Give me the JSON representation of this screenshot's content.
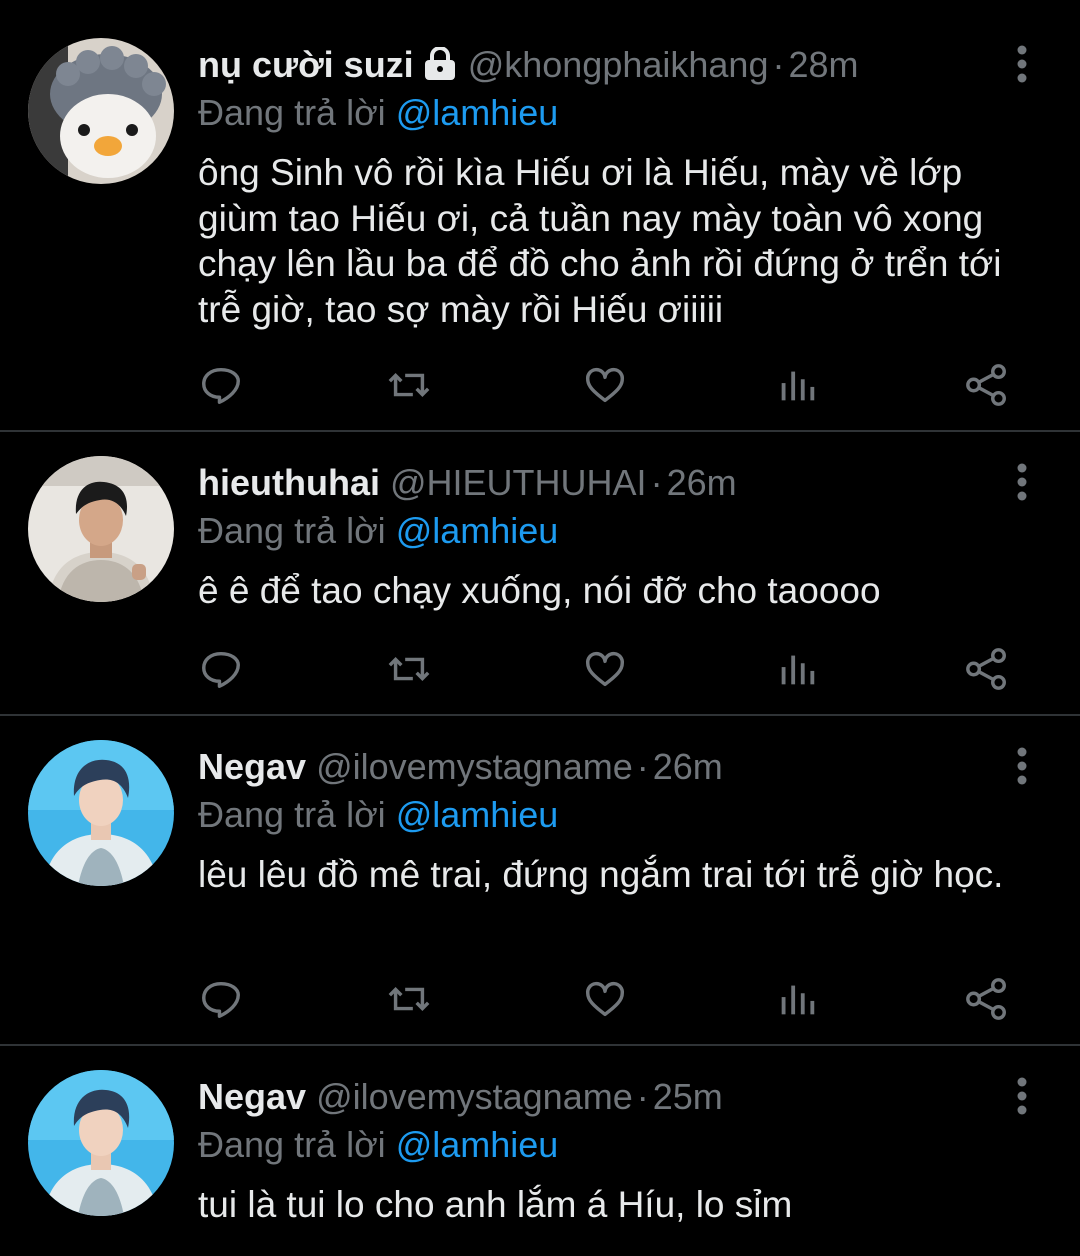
{
  "colors": {
    "background": "#000000",
    "text": "#e7e9ea",
    "muted": "#71767b",
    "accent": "#1d9bf0",
    "divider": "#2f3336"
  },
  "tweets": [
    {
      "name": "nụ cười suzi",
      "protected": true,
      "handle": "@khongphaikhang",
      "dot": "·",
      "time": "28m",
      "reply_prefix": "Đang trả lời",
      "reply_to": "@lamhieu",
      "text": "ông Sinh vô rồi kìa Hiếu ơi là Hiếu, mày về lớp giùm tao Hiếu ơi, cả tuần nay mày toàn vô xong chạy lên lầu ba để đồ cho ảnh rồi đứng ở trển tới trễ giờ, tao sợ mày rồi Hiếu ơiiiii",
      "avatar": "penguin-plush-avatar"
    },
    {
      "name": "hieuthuhai",
      "protected": false,
      "handle": "@HIEUTHUHAI",
      "dot": "·",
      "time": "26m",
      "reply_prefix": "Đang trả lời",
      "reply_to": "@lamhieu",
      "text": "ê ê để tao chạy xuống, nói đỡ cho taoooo",
      "avatar": "person-photo-avatar"
    },
    {
      "name": "Negav",
      "protected": false,
      "handle": "@ilovemystagname",
      "dot": "·",
      "time": "26m",
      "reply_prefix": "Đang trả lời",
      "reply_to": "@lamhieu",
      "text": "lêu lêu đồ mê trai, đứng ngắm trai tới trễ giờ học.",
      "avatar": "person-blue-photo-avatar"
    },
    {
      "name": "Negav",
      "protected": false,
      "handle": "@ilovemystagname",
      "dot": "·",
      "time": "25m",
      "reply_prefix": "Đang trả lời",
      "reply_to": "@lamhieu",
      "text": "tui là tui lo cho anh lắm á Híu, lo sỉm",
      "avatar": "person-blue-photo-avatar"
    }
  ]
}
